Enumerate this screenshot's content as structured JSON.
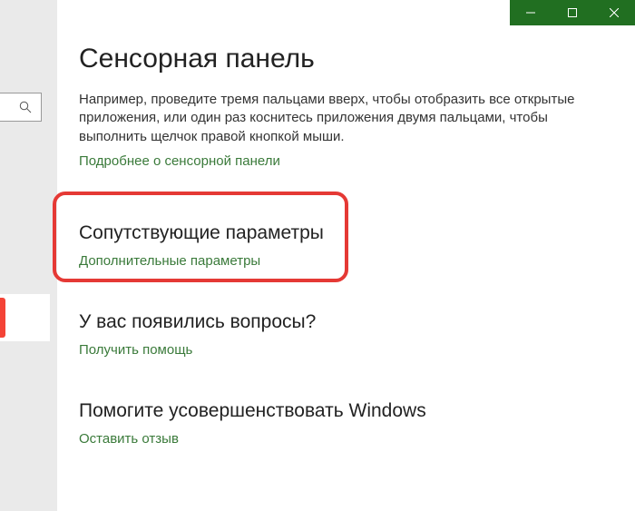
{
  "titlebar": {
    "minimize": "minimize",
    "maximize": "maximize",
    "close": "close"
  },
  "header": {
    "title": "Сенсорная панель",
    "description": "Например, проведите тремя пальцами вверх, чтобы отобразить все открытые приложения, или один раз коснитесь приложения двумя пальцами, чтобы выполнить щелчок правой кнопкой мыши.",
    "link": "Подробнее о сенсорной панели"
  },
  "sections": [
    {
      "heading": "Сопутствующие параметры",
      "link": "Дополнительные параметры"
    },
    {
      "heading": "У вас появились вопросы?",
      "link": "Получить помощь"
    },
    {
      "heading": "Помогите усовершенствовать Windows",
      "link": "Оставить отзыв"
    }
  ]
}
